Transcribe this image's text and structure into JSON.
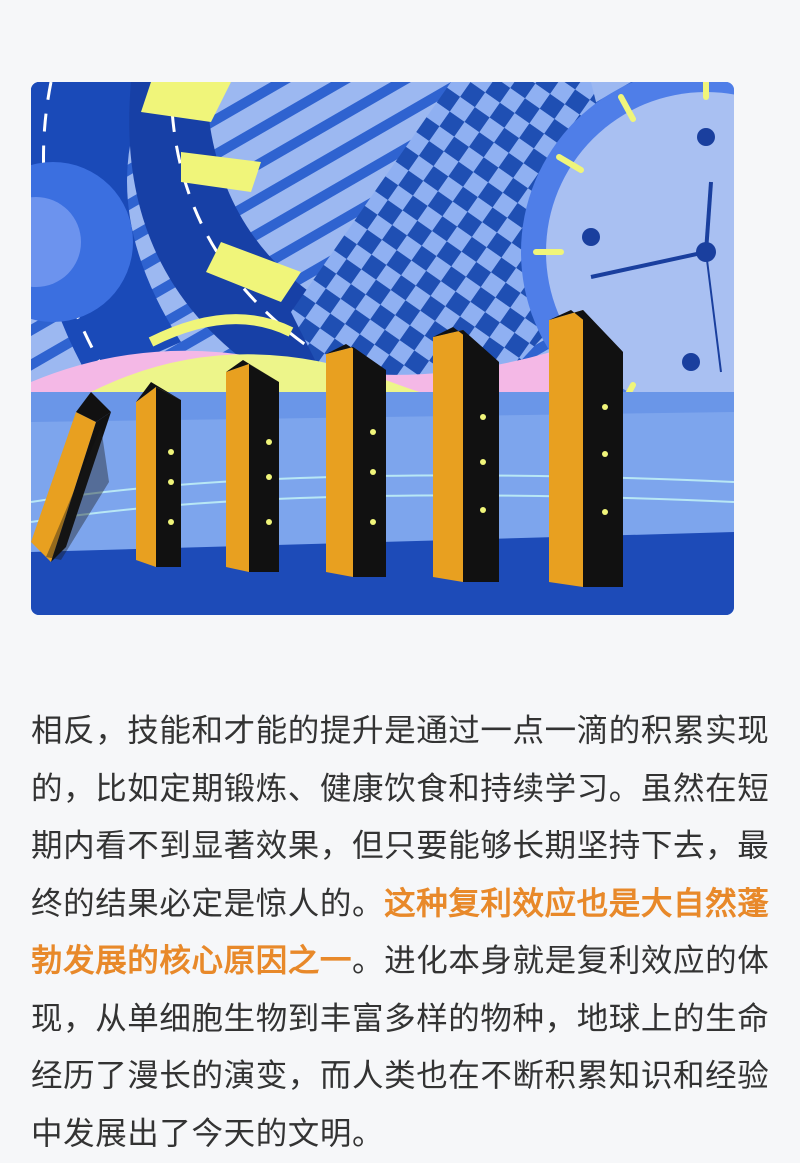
{
  "article": {
    "text_1": "相反，技能和才能的提升是通过一点一滴的积累实现的，比如定期锻炼、健康饮食和持续学习。虽然在短期内看不到显著效果，但只要能够长期坚持下去，最终的结果必定是惊人的。",
    "highlight": "这种复利效应也是大自然蓬勃发展的核心原因之一",
    "text_2": "。进化本身就是复利效应的体现，从单细胞生物到丰富多样的物种，地球上的生命经历了漫长的演变，而人类也在不断积累知识和经验中发展出了今天的文明。"
  },
  "colors": {
    "highlight": "#e8892a",
    "body_text": "#333333",
    "page_bg": "#f6f7f9"
  }
}
